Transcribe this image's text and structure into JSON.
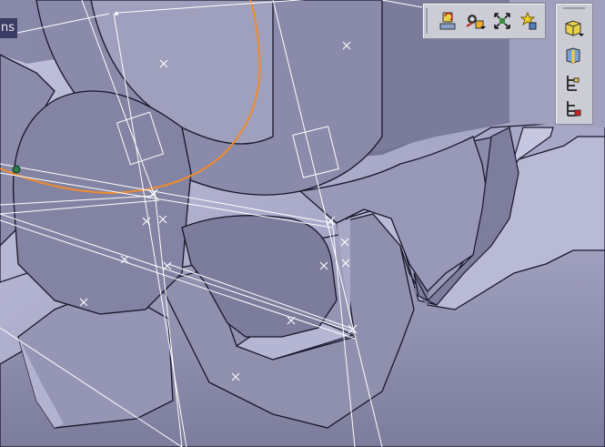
{
  "viewer": {
    "partial_label": "ns",
    "colors": {
      "background": "#a2a3c2",
      "part_face": "#9394b2",
      "part_dark": "#6e6f8e",
      "rack_top": "#b0b1cf",
      "edge": "#16162a",
      "construction_line": "#ffffff",
      "pitch_circle": "#f08a2a",
      "label_bg": "#3b3b63"
    }
  },
  "toolbar_top": {
    "buttons": [
      {
        "icon": "swap-visible-space-icon"
      },
      {
        "icon": "hide-show-icon"
      },
      {
        "icon": "fit-all-in-icon"
      },
      {
        "icon": "fly-mode-icon"
      }
    ]
  },
  "toolbar_right": {
    "buttons": [
      {
        "icon": "part-body-icon"
      },
      {
        "icon": "geometrical-set-icon"
      },
      {
        "icon": "specification-tree-icon"
      },
      {
        "icon": "tree-expand-icon"
      }
    ]
  }
}
